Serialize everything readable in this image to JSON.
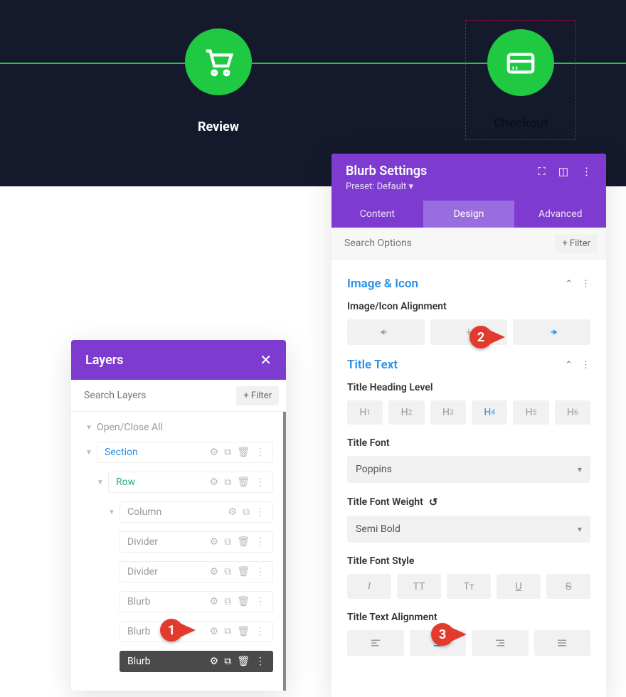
{
  "steps": {
    "review": "Review",
    "checkout": "Checkout"
  },
  "layers": {
    "title": "Layers",
    "search_placeholder": "Search Layers",
    "filter": "+ Filter",
    "open_close": "Open/Close All",
    "section": "Section",
    "row": "Row",
    "column": "Column",
    "divider": "Divider",
    "blurb": "Blurb"
  },
  "settings": {
    "title": "Blurb Settings",
    "preset": "Preset: Default",
    "tabs": {
      "content": "Content",
      "design": "Design",
      "advanced": "Advanced"
    },
    "search_placeholder": "Search Options",
    "filter": "+ Filter",
    "image_icon": "Image & Icon",
    "img_align": "Image/Icon Alignment",
    "title_text": "Title Text",
    "heading_level": "Title Heading Level",
    "h": {
      "h1": "H",
      "h2": "H",
      "h3": "H",
      "h4": "H",
      "h5": "H",
      "h6": "H"
    },
    "font_label": "Title Font",
    "font": "Poppins",
    "weight_label": "Title Font Weight",
    "weight": "Semi Bold",
    "style_label": "Title Font Style",
    "style": {
      "i": "I",
      "tt": "TT",
      "tc": "Tᴛ",
      "u": "U",
      "s": "S"
    },
    "align_label": "Title Text Alignment"
  },
  "callouts": {
    "c1": "1",
    "c2": "2",
    "c3": "3"
  }
}
